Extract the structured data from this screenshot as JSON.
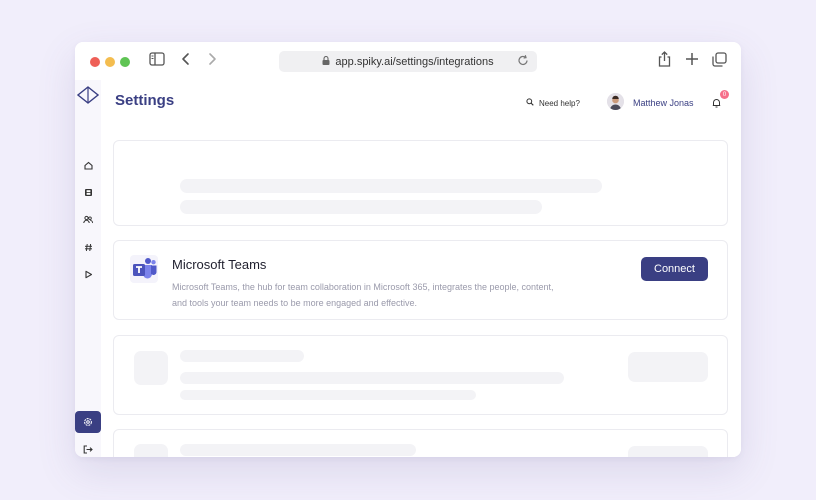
{
  "browser": {
    "url": "app.spiky.ai/settings/integrations"
  },
  "header": {
    "title": "Settings",
    "help_label": "Need help?",
    "user_name": "Matthew Jonas",
    "notification_count": "0"
  },
  "sidebar": {
    "items": [
      {
        "icon": "logo-icon"
      },
      {
        "icon": "home-icon"
      },
      {
        "icon": "film-icon"
      },
      {
        "icon": "users-icon"
      },
      {
        "icon": "hashtag-icon"
      },
      {
        "icon": "play-icon"
      },
      {
        "icon": "settings-icon",
        "active": true
      },
      {
        "icon": "logout-icon"
      }
    ]
  },
  "integration": {
    "name": "Microsoft Teams",
    "description": "Microsoft Teams, the hub for team collaboration in Microsoft 365, integrates the people, content, and tools your team needs to be more engaged and effective.",
    "button_label": "Connect"
  },
  "colors": {
    "accent": "#3a3f83",
    "badge": "#f66f8a",
    "background": "#f1eefb"
  }
}
